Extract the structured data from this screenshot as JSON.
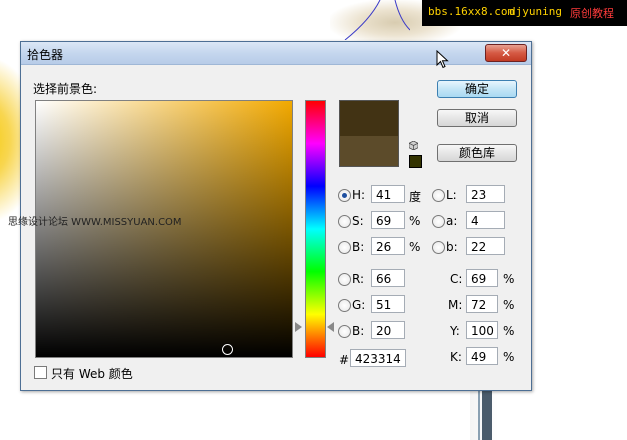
{
  "banner": {
    "site": "bbs.16xx8.com",
    "author": "djyuning",
    "tag": "原创教程"
  },
  "watermark": "思缘设计论坛 WWW.MISSYUAN.COM",
  "dialog": {
    "title": "拾色器",
    "close_glyph": "✕",
    "select_label": "选择前景色:",
    "buttons": {
      "ok": "确定",
      "cancel": "取消",
      "library": "颜色库"
    },
    "fields": {
      "H": {
        "label": "H:",
        "value": "41",
        "unit": "度",
        "selected": true
      },
      "S": {
        "label": "S:",
        "value": "69",
        "unit": "%"
      },
      "Bv": {
        "label": "B:",
        "value": "26",
        "unit": "%"
      },
      "R": {
        "label": "R:",
        "value": "66"
      },
      "G": {
        "label": "G:",
        "value": "51"
      },
      "Bc": {
        "label": "B:",
        "value": "20"
      },
      "L": {
        "label": "L:",
        "value": "23"
      },
      "a": {
        "label": "a:",
        "value": "4"
      },
      "b": {
        "label": "b:",
        "value": "22"
      },
      "C": {
        "label": "C:",
        "value": "69",
        "unit": "%"
      },
      "M": {
        "label": "M:",
        "value": "72",
        "unit": "%"
      },
      "Y": {
        "label": "Y:",
        "value": "100",
        "unit": "%"
      },
      "K": {
        "label": "K:",
        "value": "49",
        "unit": "%"
      },
      "hex": {
        "label": "#",
        "value": "423314"
      }
    },
    "websafe_label": "只有 Web 颜色"
  },
  "colors": {
    "new_color": "#423314",
    "current_color": "#5c4b2a",
    "hue_base": "#f2a900",
    "websafe_swatch": "#333300"
  },
  "icons": [
    "close-icon",
    "cube-icon",
    "cursor-icon"
  ]
}
